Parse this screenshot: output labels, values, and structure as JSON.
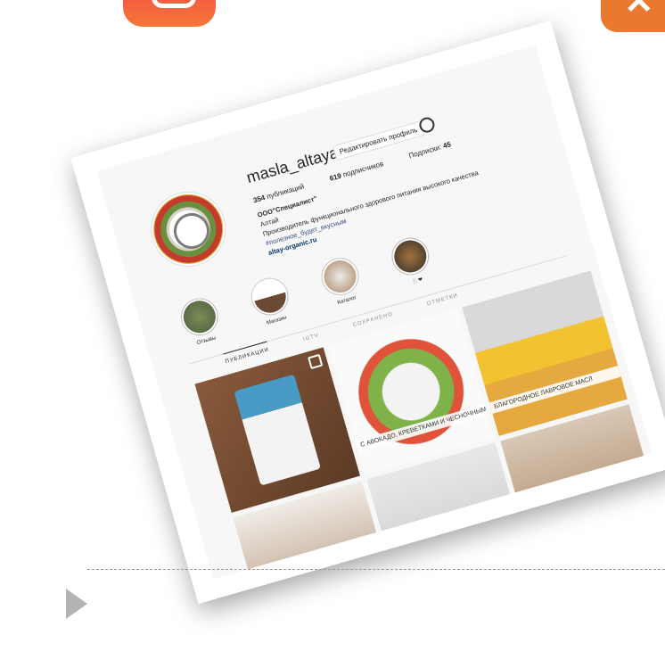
{
  "slide": {
    "instagram_icon": "instagram-icon",
    "close_icon": "close-icon",
    "close_glyph": "✕",
    "play_icon": "play-icon"
  },
  "profile": {
    "username": "masla_altaya",
    "edit_button": "Редактировать профиль",
    "settings_icon": "gear-icon",
    "stats": {
      "posts": "354",
      "posts_label": "публикаций",
      "followers": "619",
      "followers_label": "подписчиков",
      "following_label": "Подписки:",
      "following": "45"
    },
    "bio": {
      "name": "ООО\"Специалист\"",
      "line1": "Алтай",
      "line2": "Производитель функционального здорового питания высокого качества",
      "hashtag": "#полезное_будет_вкусным",
      "link": "altay-organic.ru"
    },
    "highlights": [
      {
        "label": "Отзывы"
      },
      {
        "label": "Магазин"
      },
      {
        "label": "Каталог"
      },
      {
        "label": "🍴❤"
      }
    ],
    "tabs": [
      "ПУБЛИКАЦИИ",
      "IGTV",
      "СОХРАНЕНО",
      "ОТМЕТКИ"
    ],
    "posts": [
      {
        "caption": ""
      },
      {
        "caption": "С АВОКАДО, КРЕВЕТКАМИ И ЧЕСНОЧНЫМ МА"
      },
      {
        "caption": "БЛАГОРОДНОЕ ЛАВРОВОЕ МАСЛ"
      },
      {
        "caption": ""
      },
      {
        "caption": ""
      },
      {
        "caption": ""
      }
    ]
  }
}
